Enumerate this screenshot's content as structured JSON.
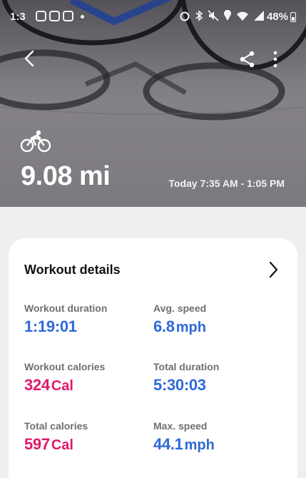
{
  "status_bar": {
    "time": "1:3",
    "battery": "48%"
  },
  "header": {
    "distance": "9.08 mi",
    "time_range": "Today 7:35 AM - 1:05 PM",
    "activity_icon": "cycling-icon"
  },
  "card": {
    "title": "Workout details",
    "stats": [
      {
        "label": "Workout duration",
        "value": "1:19:01",
        "unit": "",
        "color": "#2f69d9"
      },
      {
        "label": "Avg. speed",
        "value": "6.8",
        "unit": "mph",
        "color": "#2f69d9"
      },
      {
        "label": "Workout calories",
        "value": "324",
        "unit": "Cal",
        "color": "#e0196b"
      },
      {
        "label": "Total duration",
        "value": "5:30:03",
        "unit": "",
        "color": "#2f69d9"
      },
      {
        "label": "Total calories",
        "value": "597",
        "unit": "Cal",
        "color": "#e0196b"
      },
      {
        "label": "Max. speed",
        "value": "44.1",
        "unit": "mph",
        "color": "#2f69d9"
      }
    ]
  },
  "icons": [
    "back-arrow-icon",
    "share-icon",
    "more-vertical-icon",
    "chevron-right-icon",
    "cycling-icon"
  ]
}
